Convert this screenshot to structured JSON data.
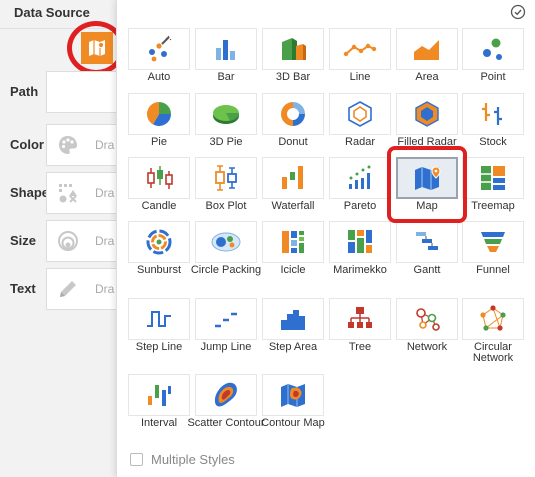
{
  "panel": {
    "title": "Data Source",
    "rows": [
      {
        "label": "Path",
        "placeholder": ""
      },
      {
        "label": "Color",
        "placeholder": "Dra"
      },
      {
        "label": "Shape",
        "placeholder": "Dra"
      },
      {
        "label": "Size",
        "placeholder": "Dra"
      },
      {
        "label": "Text",
        "placeholder": "Dra"
      }
    ],
    "active_chart_icon": "map-icon",
    "accent_color": "#f08a24"
  },
  "popup": {
    "chart_types": [
      {
        "label": "Auto",
        "icon": "auto-icon"
      },
      {
        "label": "Bar",
        "icon": "bar-chart-icon"
      },
      {
        "label": "3D Bar",
        "icon": "3d-bar-icon"
      },
      {
        "label": "Line",
        "icon": "line-chart-icon"
      },
      {
        "label": "Area",
        "icon": "area-chart-icon"
      },
      {
        "label": "Point",
        "icon": "point-chart-icon"
      },
      {
        "label": "Pie",
        "icon": "pie-chart-icon"
      },
      {
        "label": "3D Pie",
        "icon": "3d-pie-icon"
      },
      {
        "label": "Donut",
        "icon": "donut-chart-icon"
      },
      {
        "label": "Radar",
        "icon": "radar-chart-icon"
      },
      {
        "label": "Filled Radar",
        "icon": "filled-radar-icon"
      },
      {
        "label": "Stock",
        "icon": "stock-chart-icon"
      },
      {
        "label": "Candle",
        "icon": "candle-chart-icon"
      },
      {
        "label": "Box Plot",
        "icon": "box-plot-icon"
      },
      {
        "label": "Waterfall",
        "icon": "waterfall-icon"
      },
      {
        "label": "Pareto",
        "icon": "pareto-icon"
      },
      {
        "label": "Map",
        "icon": "map-icon",
        "selected": true
      },
      {
        "label": "Treemap",
        "icon": "treemap-icon"
      },
      {
        "label": "Sunburst",
        "icon": "sunburst-icon"
      },
      {
        "label": "Circle Packing",
        "icon": "circle-packing-icon"
      },
      {
        "label": "Icicle",
        "icon": "icicle-icon"
      },
      {
        "label": "Marimekko",
        "icon": "marimekko-icon"
      },
      {
        "label": "Gantt",
        "icon": "gantt-icon"
      },
      {
        "label": "Funnel",
        "icon": "funnel-icon"
      },
      {
        "label": "Step Line",
        "icon": "step-line-icon"
      },
      {
        "label": "Jump Line",
        "icon": "jump-line-icon"
      },
      {
        "label": "Step Area",
        "icon": "step-area-icon"
      },
      {
        "label": "Tree",
        "icon": "tree-icon"
      },
      {
        "label": "Network",
        "icon": "network-icon"
      },
      {
        "label": "Circular Network",
        "icon": "circular-network-icon"
      },
      {
        "label": "Interval",
        "icon": "interval-icon"
      },
      {
        "label": "Scatter Contour",
        "icon": "scatter-contour-icon"
      },
      {
        "label": "Contour Map",
        "icon": "contour-map-icon"
      }
    ],
    "multiple_styles_label": "Multiple Styles",
    "multiple_styles_checked": false,
    "close_icon": "check-circle-icon"
  }
}
